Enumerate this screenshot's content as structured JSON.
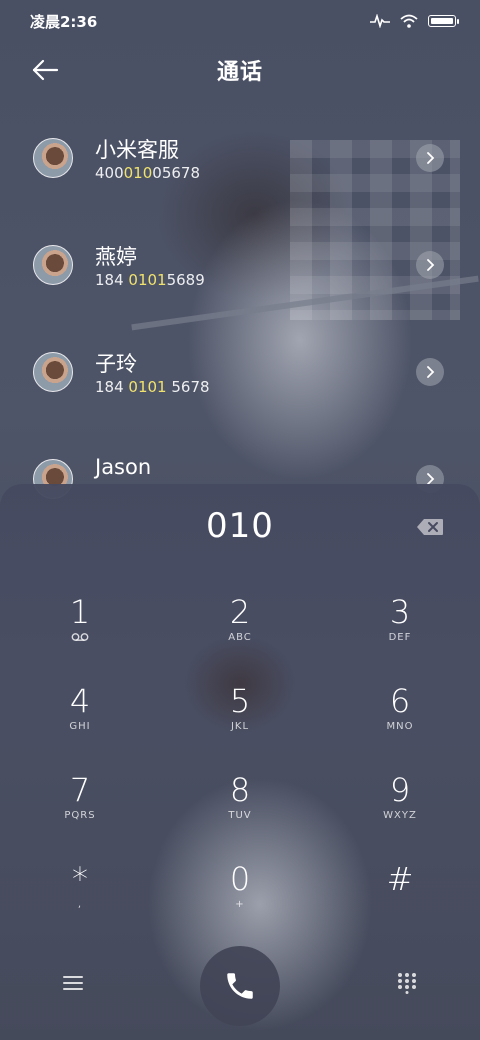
{
  "status_bar": {
    "time": "凌晨2:36"
  },
  "header": {
    "title": "通话"
  },
  "contacts": [
    {
      "name": "小米客服",
      "number_parts": [
        "400",
        "010",
        "05678"
      ]
    },
    {
      "name": "燕婷",
      "number_parts": [
        "184 ",
        "0101",
        "5689"
      ]
    },
    {
      "name": "子玲",
      "number_parts": [
        "184 ",
        "0101",
        " 5678"
      ]
    },
    {
      "name": "Jason",
      "number_parts": [
        "",
        "",
        ""
      ]
    }
  ],
  "dialpad": {
    "dialed_number": "010",
    "keys": [
      {
        "digit": "1",
        "sub": ""
      },
      {
        "digit": "2",
        "sub": "ABC"
      },
      {
        "digit": "3",
        "sub": "DEF"
      },
      {
        "digit": "4",
        "sub": "GHI"
      },
      {
        "digit": "5",
        "sub": "JKL"
      },
      {
        "digit": "6",
        "sub": "MNO"
      },
      {
        "digit": "7",
        "sub": "PQRS"
      },
      {
        "digit": "8",
        "sub": "TUV"
      },
      {
        "digit": "9",
        "sub": "WXYZ"
      },
      {
        "digit": "*",
        "sub": ","
      },
      {
        "digit": "0",
        "sub": "+"
      },
      {
        "digit": "#",
        "sub": ""
      }
    ]
  },
  "colors": {
    "highlight": "#f0e26e",
    "panel": "#464a60"
  }
}
